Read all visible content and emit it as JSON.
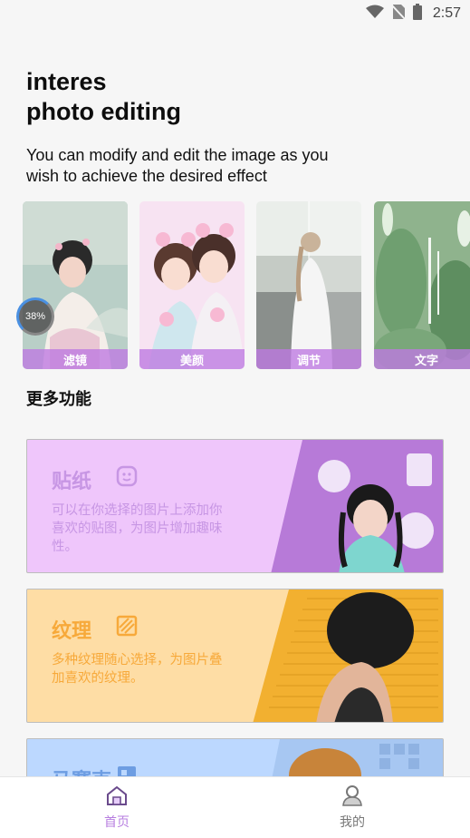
{
  "status_bar": {
    "time": "2:57",
    "icons": [
      "wifi-icon",
      "no-sim-icon",
      "battery-icon"
    ]
  },
  "hero": {
    "title_line1": "interes",
    "title_line2": "photo editing",
    "subtitle": "You can modify and edit the image as you wish to achieve the desired effect"
  },
  "features": [
    {
      "label": "滤镜",
      "icon": "filter-photo"
    },
    {
      "label": "美颜",
      "icon": "beauty-photo"
    },
    {
      "label": "调节",
      "icon": "adjust-photo"
    },
    {
      "label": "文字",
      "icon": "text-photo"
    }
  ],
  "progress": {
    "text": "38%",
    "value": 0.38
  },
  "more_section": {
    "title": "更多功能"
  },
  "promos": [
    {
      "title": "贴纸",
      "icon": "sticker-icon",
      "desc": "可以在你选择的图片上添加你喜欢的贴图，为图片增加趣味性。",
      "accent": "#c796e4",
      "bg": "#efc6fb"
    },
    {
      "title": "纹理",
      "icon": "texture-icon",
      "desc": "多种纹理随心选择，为图片叠加喜欢的纹理。",
      "accent": "#f7a93a",
      "bg": "#fedda5"
    },
    {
      "title": "马赛克",
      "icon": "mosaic-icon",
      "desc": "",
      "accent": "#6d9de2",
      "bg": "#bcd8ff"
    }
  ],
  "bottom_nav": {
    "home_label": "首页",
    "mine_label": "我的"
  },
  "colors": {
    "accent_purple": "#b77ee0",
    "background": "#f6f6f6"
  }
}
